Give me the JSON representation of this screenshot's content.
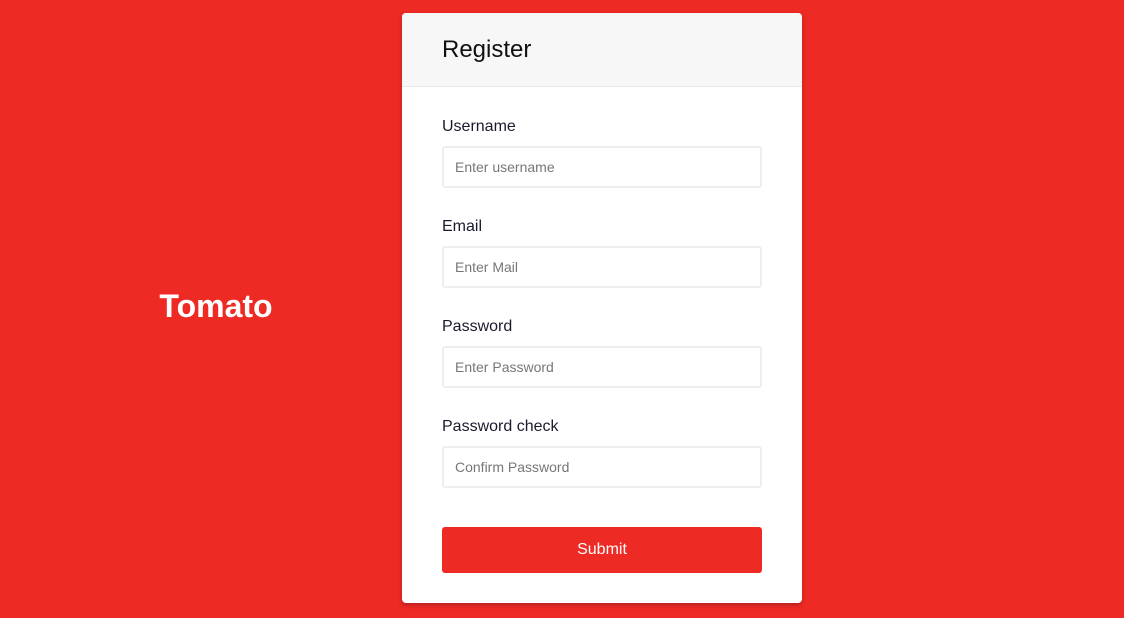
{
  "brand": "Tomato",
  "form": {
    "title": "Register",
    "fields": [
      {
        "label": "Username",
        "placeholder": "Enter username",
        "value": ""
      },
      {
        "label": "Email",
        "placeholder": "Enter Mail",
        "value": ""
      },
      {
        "label": "Password",
        "placeholder": "Enter Password",
        "value": ""
      },
      {
        "label": "Password check",
        "placeholder": "Confirm Password",
        "value": ""
      }
    ],
    "submit_label": "Submit"
  },
  "colors": {
    "background": "#ee2a24",
    "accent": "#ee2a24",
    "header": "#f7f7f7"
  }
}
